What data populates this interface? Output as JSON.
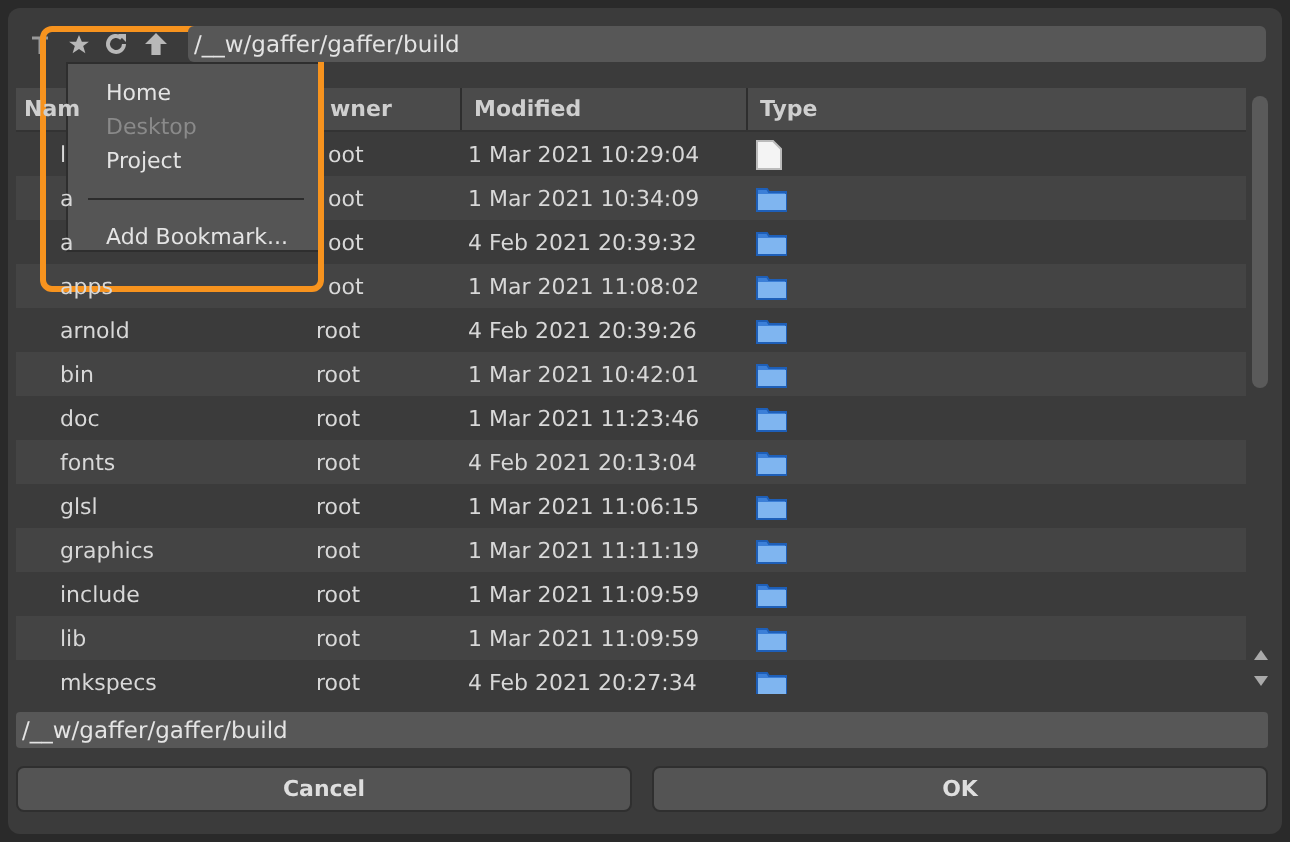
{
  "toolbar": {
    "path": "/__w/gaffer/gaffer/build"
  },
  "bookmark_menu": {
    "items": [
      {
        "label": "Home",
        "disabled": false
      },
      {
        "label": "Desktop",
        "disabled": true
      },
      {
        "label": "Project",
        "disabled": false
      }
    ],
    "action": "Add Bookmark..."
  },
  "table": {
    "columns": [
      "Nam",
      "wner",
      "Modified",
      "Type"
    ],
    "rows": [
      {
        "name": "l",
        "owner": "oot",
        "modified": "1 Mar 2021 10:29:04",
        "kind": "file"
      },
      {
        "name": "a",
        "owner": "oot",
        "modified": "1 Mar 2021 10:34:09",
        "kind": "folder"
      },
      {
        "name": "a",
        "owner": "oot",
        "modified": "4 Feb 2021 20:39:32",
        "kind": "folder"
      },
      {
        "name": "apps",
        "owner": "oot",
        "modified": "1 Mar 2021 11:08:02",
        "kind": "folder"
      },
      {
        "name": "arnold",
        "owner": "root",
        "modified": "4 Feb 2021 20:39:26",
        "kind": "folder"
      },
      {
        "name": "bin",
        "owner": "root",
        "modified": "1 Mar 2021 10:42:01",
        "kind": "folder"
      },
      {
        "name": "doc",
        "owner": "root",
        "modified": "1 Mar 2021 11:23:46",
        "kind": "folder"
      },
      {
        "name": "fonts",
        "owner": "root",
        "modified": "4 Feb 2021 20:13:04",
        "kind": "folder"
      },
      {
        "name": "glsl",
        "owner": "root",
        "modified": "1 Mar 2021 11:06:15",
        "kind": "folder"
      },
      {
        "name": "graphics",
        "owner": "root",
        "modified": "1 Mar 2021 11:11:19",
        "kind": "folder"
      },
      {
        "name": "include",
        "owner": "root",
        "modified": "1 Mar 2021 11:09:59",
        "kind": "folder"
      },
      {
        "name": "lib",
        "owner": "root",
        "modified": "1 Mar 2021 11:09:59",
        "kind": "folder"
      },
      {
        "name": "mkspecs",
        "owner": "root",
        "modified": "4 Feb 2021 20:27:34",
        "kind": "folder"
      }
    ]
  },
  "path_field": {
    "value": "/__w/gaffer/gaffer/build"
  },
  "buttons": [
    "Cancel",
    "OK"
  ]
}
